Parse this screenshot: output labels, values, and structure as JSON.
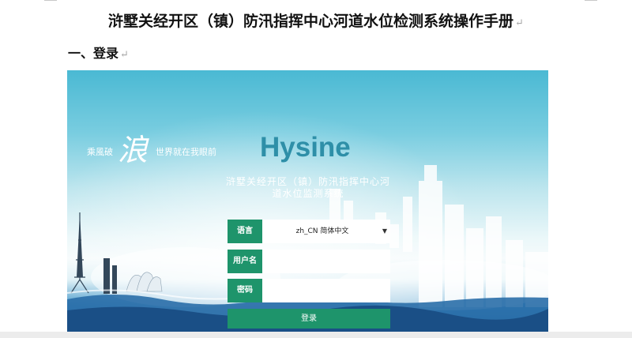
{
  "document": {
    "title": "浒墅关经开区（镇）防汛指挥中心河道水位检测系统操作手册",
    "para_mark": "↵",
    "section_heading": "一、登录"
  },
  "login_screen": {
    "slogan_left": "乘風破",
    "slogan_big": "浪",
    "slogan_right": "世界就在我眼前",
    "brand": "Hysine",
    "system_name_line1": "浒墅关经开区（镇）防汛指挥中心河",
    "system_name_line2": "道水位监测系统",
    "language_label": "语言",
    "language_value": "zh_CN 简体中文",
    "username_label": "用户名",
    "password_label": "密码",
    "login_button": "登录"
  }
}
